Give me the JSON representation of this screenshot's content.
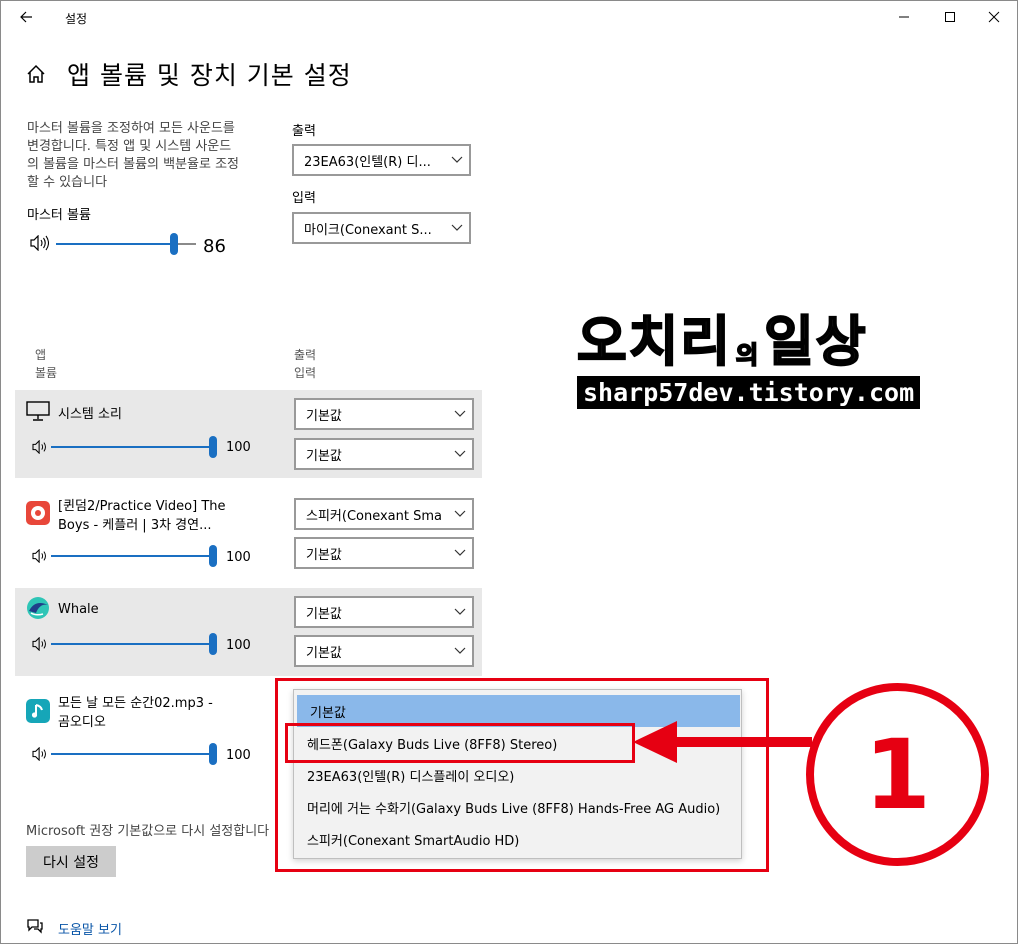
{
  "window": {
    "title": "설정",
    "back_icon": "arrow-left-icon",
    "controls": [
      "minimize-icon",
      "maximize-icon",
      "close-icon"
    ]
  },
  "page": {
    "home_icon": "home-icon",
    "title": "앱 볼륨 및 장치 기본 설정"
  },
  "master": {
    "description": [
      "마스터 볼륨을 조정하여 모든 사운드를",
      "변경합니다. 특정 앱 및 시스템 사운드",
      "의 볼륨을 마스터 볼륨의 백분율로 조정",
      "할 수 있습니다"
    ],
    "label": "마스터 볼륨",
    "value": "86",
    "level": 0.86
  },
  "devices": {
    "output_label": "출력",
    "output_value": "23EA63(인텔(R) 디...",
    "input_label": "입력",
    "input_value": "마이크(Conexant S..."
  },
  "table_headers": {
    "app_line1": "앱",
    "app_line2": "볼륨",
    "io_line1": "출력",
    "io_line2": "입력"
  },
  "apps": [
    {
      "name": "시스템 소리",
      "icon": "monitor-icon",
      "volume": "100",
      "output": "기본값",
      "input": "기본값"
    },
    {
      "name_line1": "[퀸덤2/Practice Video] The",
      "name_line2": "Boys - 케플러 | 3차 경연...",
      "icon": "potplayer-icon",
      "volume": "100",
      "output": "스피커(Conexant Sma",
      "input": "기본값"
    },
    {
      "name": "Whale",
      "icon": "whale-browser-icon",
      "volume": "100",
      "output": "기본값",
      "input": "기본값"
    },
    {
      "name_line1": "모든 날 모든 순간02.mp3 -",
      "name_line2": "곰오디오",
      "icon": "gomaudio-icon",
      "volume": "100"
    }
  ],
  "dropdown": {
    "options": [
      "기본값",
      "헤드폰(Galaxy Buds Live (8FF8) Stereo)",
      "23EA63(인텔(R) 디스플레이 오디오)",
      "머리에 거는 수화기(Galaxy Buds Live (8FF8) Hands-Free AG Audio)",
      "스피커(Conexant SmartAudio HD)"
    ],
    "selected_index": 0
  },
  "reset": {
    "description": "Microsoft 권장 기본값으로 다시 설정합니다",
    "button_label": "다시 설정"
  },
  "help": {
    "icon": "chat-help-icon",
    "label": "도움말 보기"
  },
  "annotation": {
    "number": "1",
    "color": "#e60012"
  },
  "watermark": {
    "title_part1": "오치리",
    "title_part2": "의",
    "title_part3": "일상",
    "subtitle": "sharp57dev.tistory.com"
  },
  "colors": {
    "accent": "#1a6fc2",
    "row_bg": "#e8e8e8",
    "selected_option": "#8ab8ea",
    "link": "#0a56a8"
  }
}
